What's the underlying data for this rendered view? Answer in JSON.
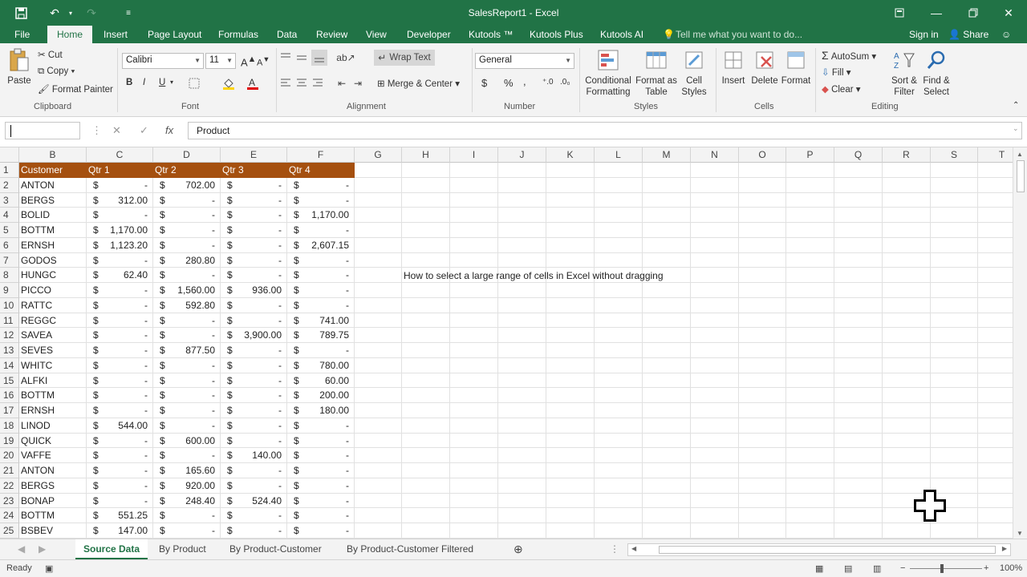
{
  "window": {
    "title": "SalesReport1 - Excel"
  },
  "menu": {
    "tabs": [
      "File",
      "Home",
      "Insert",
      "Page Layout",
      "Formulas",
      "Data",
      "Review",
      "View",
      "Developer",
      "Kutools ™",
      "Kutools Plus",
      "Kutools AI"
    ],
    "active_tab": "Home",
    "tell_me": "Tell me what you want to do...",
    "sign_in": "Sign in",
    "share": "Share"
  },
  "ribbon": {
    "clipboard": {
      "paste": "Paste",
      "cut": "Cut",
      "copy": "Copy",
      "format_painter": "Format Painter",
      "label": "Clipboard"
    },
    "font": {
      "name": "Calibri",
      "size": "11",
      "bold": "B",
      "italic": "I",
      "underline": "U",
      "label": "Font"
    },
    "alignment": {
      "wrap_text": "Wrap Text",
      "merge_center": "Merge & Center",
      "label": "Alignment"
    },
    "number": {
      "format": "General",
      "currency": "$",
      "percent": "%",
      "comma": ",",
      "label": "Number"
    },
    "styles": {
      "conditional": "Conditional",
      "conditional2": "Formatting",
      "format_as": "Format as",
      "format_as2": "Table",
      "cell": "Cell",
      "cell2": "Styles",
      "label": "Styles"
    },
    "cells": {
      "insert": "Insert",
      "delete": "Delete",
      "format": "Format",
      "label": "Cells"
    },
    "editing": {
      "autosum": "AutoSum",
      "fill": "Fill",
      "clear": "Clear",
      "sort": "Sort &",
      "sort2": "Filter",
      "find": "Find &",
      "find2": "Select",
      "label": "Editing"
    }
  },
  "formula_bar": {
    "name_box": "",
    "content": "Product"
  },
  "columns": [
    "B",
    "C",
    "D",
    "E",
    "F",
    "G",
    "H",
    "I",
    "J",
    "K",
    "L",
    "M",
    "N",
    "O",
    "P",
    "Q",
    "R",
    "S",
    "T"
  ],
  "table": {
    "headers": [
      "Customer",
      "Qtr 1",
      "Qtr 2",
      "Qtr 3",
      "Qtr 4"
    ],
    "rows": [
      [
        "ANTON",
        "-",
        "702.00",
        "-",
        "-"
      ],
      [
        "BERGS",
        "312.00",
        "-",
        "-",
        "-"
      ],
      [
        "BOLID",
        "-",
        "-",
        "-",
        "1,170.00"
      ],
      [
        "BOTTM",
        "1,170.00",
        "-",
        "-",
        "-"
      ],
      [
        "ERNSH",
        "1,123.20",
        "-",
        "-",
        "2,607.15"
      ],
      [
        "GODOS",
        "-",
        "280.80",
        "-",
        "-"
      ],
      [
        "HUNGC",
        "62.40",
        "-",
        "-",
        "-"
      ],
      [
        "PICCO",
        "-",
        "1,560.00",
        "936.00",
        "-"
      ],
      [
        "RATTC",
        "-",
        "592.80",
        "-",
        "-"
      ],
      [
        "REGGC",
        "-",
        "-",
        "-",
        "741.00"
      ],
      [
        "SAVEA",
        "-",
        "-",
        "3,900.00",
        "789.75"
      ],
      [
        "SEVES",
        "-",
        "877.50",
        "-",
        "-"
      ],
      [
        "WHITC",
        "-",
        "-",
        "-",
        "780.00"
      ],
      [
        "ALFKI",
        "-",
        "-",
        "-",
        "60.00"
      ],
      [
        "BOTTM",
        "-",
        "-",
        "-",
        "200.00"
      ],
      [
        "ERNSH",
        "-",
        "-",
        "-",
        "180.00"
      ],
      [
        "LINOD",
        "544.00",
        "-",
        "-",
        "-"
      ],
      [
        "QUICK",
        "-",
        "600.00",
        "-",
        "-"
      ],
      [
        "VAFFE",
        "-",
        "-",
        "140.00",
        "-"
      ],
      [
        "ANTON",
        "-",
        "165.60",
        "-",
        "-"
      ],
      [
        "BERGS",
        "-",
        "920.00",
        "-",
        "-"
      ],
      [
        "BONAP",
        "-",
        "248.40",
        "524.40",
        "-"
      ],
      [
        "BOTTM",
        "551.25",
        "-",
        "-",
        "-"
      ],
      [
        "BSBEV",
        "147.00",
        "-",
        "-",
        "-"
      ]
    ]
  },
  "currency_symbol": "$",
  "note": "How to select a large range of cells in Excel without dragging",
  "sheets": [
    "Source Data",
    "By Product",
    "By Product-Customer",
    "By Product-Customer Filtered"
  ],
  "active_sheet": "Source Data",
  "status": {
    "state": "Ready",
    "zoom": "100%"
  },
  "colors": {
    "excel_green": "#217346",
    "header_fill": "#a5500f"
  }
}
